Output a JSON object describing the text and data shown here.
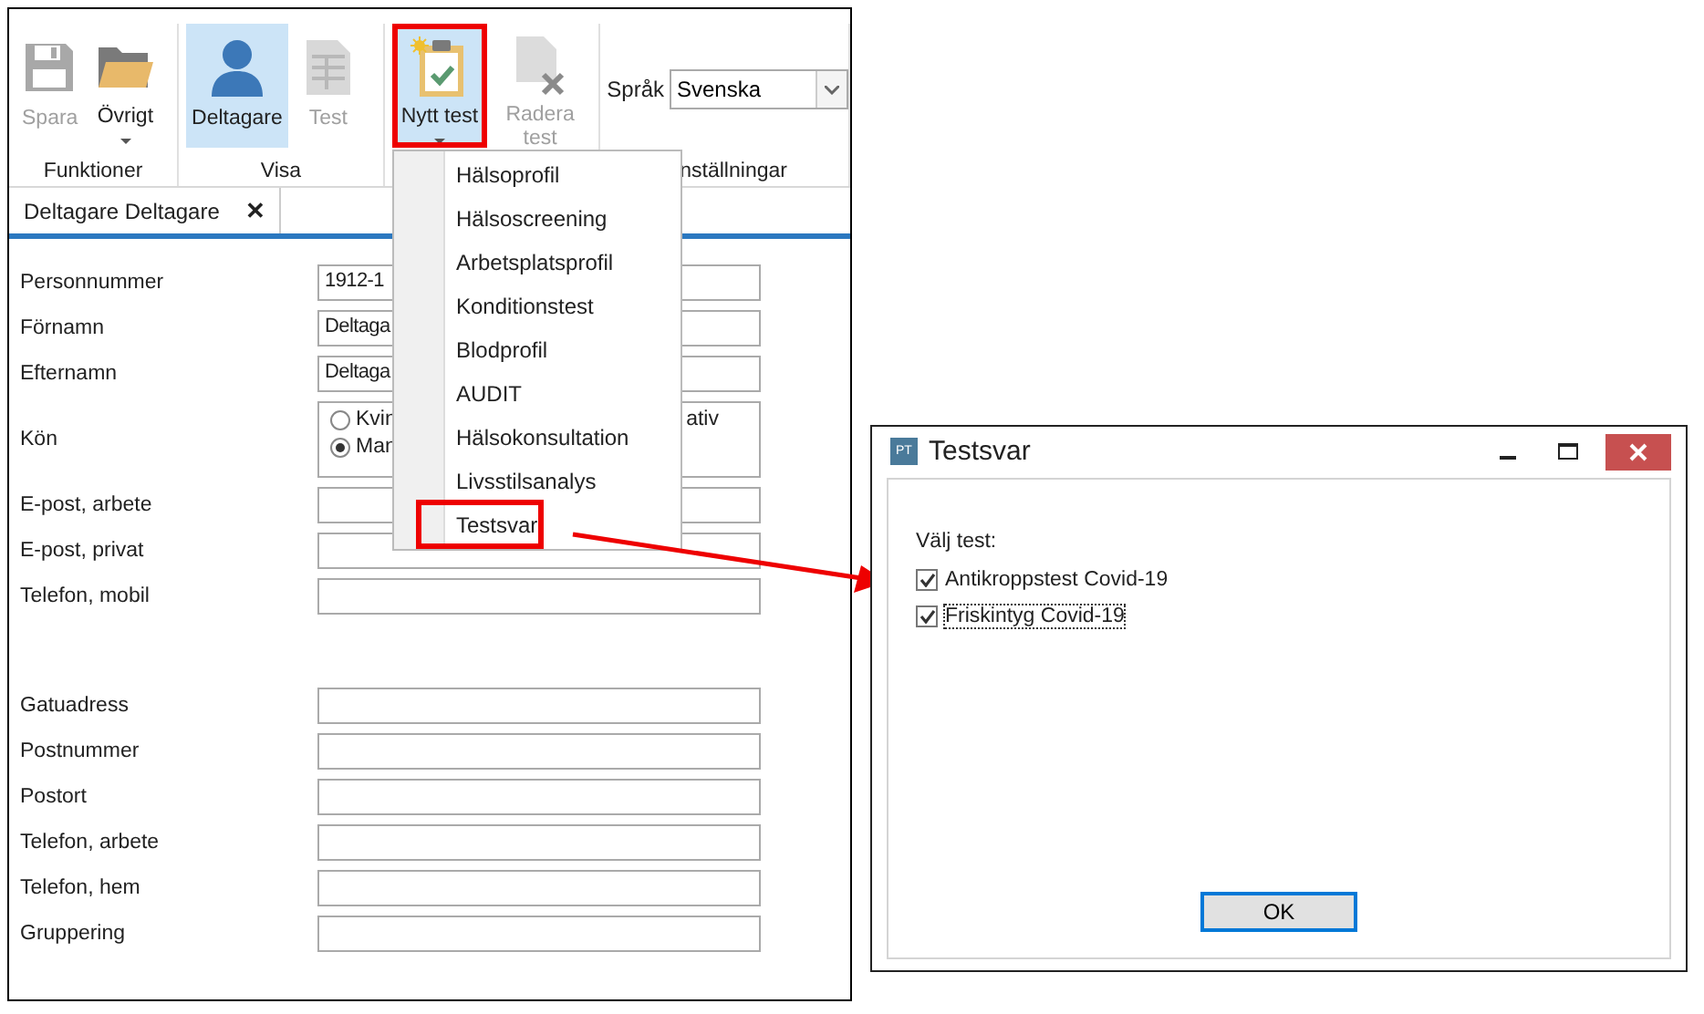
{
  "ribbon": {
    "groups": [
      {
        "label": "Funktioner",
        "buttons": [
          {
            "label": "Spara",
            "disabled": true,
            "selected": false,
            "caret": false,
            "highlighted": false
          },
          {
            "label": "Övrigt",
            "disabled": false,
            "selected": false,
            "caret": true,
            "highlighted": false
          }
        ]
      },
      {
        "label": "Visa",
        "buttons": [
          {
            "label": "Deltagare",
            "disabled": false,
            "selected": true,
            "caret": false,
            "highlighted": false
          },
          {
            "label": "Test",
            "disabled": true,
            "selected": false,
            "caret": false,
            "highlighted": false
          }
        ]
      },
      {
        "buttons": [
          {
            "label": "Nytt test",
            "disabled": false,
            "selected": true,
            "caret": true,
            "highlighted": true
          },
          {
            "label": "Radera test",
            "disabled": true,
            "selected": false,
            "caret": false,
            "highlighted": false
          }
        ]
      },
      {
        "label": "nställningar",
        "language": {
          "label": "Språk",
          "value": "Svenska"
        }
      }
    ]
  },
  "tabs": [
    {
      "label": "Deltagare Deltagare",
      "selected": true,
      "close_glyph": "✕"
    }
  ],
  "fields": [
    {
      "kind": "text",
      "label": "Personnummer",
      "value": "1912-1"
    },
    {
      "kind": "text",
      "label": "Förnamn",
      "value": "Deltaga"
    },
    {
      "kind": "text",
      "label": "Efternamn",
      "value": "Deltaga"
    },
    {
      "kind": "radio",
      "label": "Kön",
      "options": [
        {
          "label": "Kvin",
          "selected": false
        },
        {
          "label": "Man",
          "selected": true
        }
      ],
      "covered_option_text": "ativ"
    },
    {
      "kind": "text",
      "label": "E-post, arbete"
    },
    {
      "kind": "text",
      "label": "E-post, privat"
    },
    {
      "kind": "text",
      "label": "Telefon, mobil"
    }
  ],
  "address_fields": [
    {
      "kind": "text",
      "label": "Gatuadress"
    },
    {
      "kind": "text",
      "label": "Postnummer"
    },
    {
      "kind": "text",
      "label": "Postort"
    },
    {
      "kind": "text",
      "label": "Telefon, arbete"
    },
    {
      "kind": "text",
      "label": "Telefon, hem"
    },
    {
      "kind": "text",
      "label": "Gruppering"
    }
  ],
  "menu": {
    "items": [
      {
        "label": "Hälsoprofil",
        "highlighted": false
      },
      {
        "label": "Hälsoscreening",
        "highlighted": false
      },
      {
        "label": "Arbetsplatsprofil",
        "highlighted": false
      },
      {
        "label": "Konditionstest",
        "highlighted": false
      },
      {
        "label": "Blodprofil",
        "highlighted": false
      },
      {
        "label": "AUDIT",
        "highlighted": false
      },
      {
        "label": "Hälsokonsultation",
        "highlighted": false
      },
      {
        "label": "Livsstilsanalys",
        "highlighted": false
      },
      {
        "label": "Testsvar",
        "highlighted": true
      }
    ]
  },
  "dialog": {
    "app_badge": "PT",
    "title": "Testsvar",
    "prompt": "Välj test:",
    "options": [
      {
        "label": "Antikroppstest Covid-19",
        "checked": true,
        "focused": false
      },
      {
        "label": "Friskintyg Covid-19",
        "checked": true,
        "focused": true
      }
    ],
    "button": "OK"
  }
}
